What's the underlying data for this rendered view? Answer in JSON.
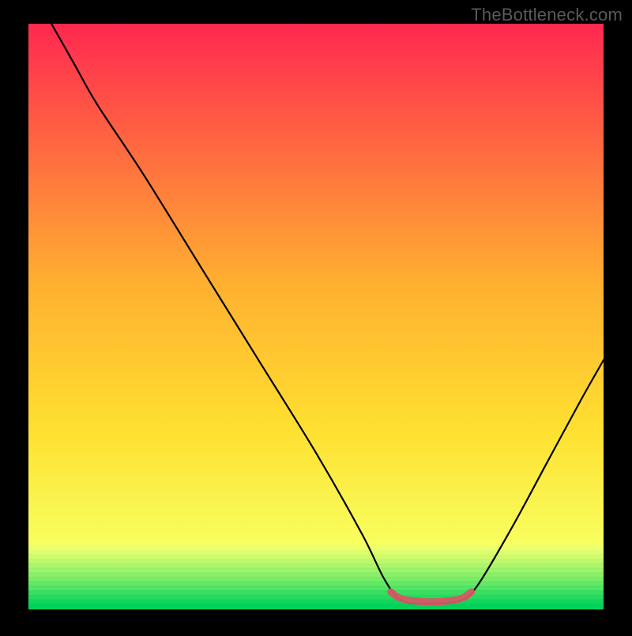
{
  "watermark": "TheBottleneck.com",
  "chart_data": {
    "type": "line",
    "title": "",
    "xlabel": "",
    "ylabel": "",
    "xlim": [
      0,
      100
    ],
    "ylim": [
      0,
      100
    ],
    "grid": false,
    "background_gradient": [
      {
        "offset": 0.0,
        "color": "#ff2850"
      },
      {
        "offset": 0.45,
        "color": "#ffb030"
      },
      {
        "offset": 0.7,
        "color": "#ffe030"
      },
      {
        "offset": 0.9,
        "color": "#f7ff60"
      },
      {
        "offset": 0.97,
        "color": "#a8ff60"
      },
      {
        "offset": 1.0,
        "color": "#00e060"
      }
    ],
    "series": [
      {
        "name": "bottleneck-curve",
        "stroke": "#000000",
        "stroke_width": 2.2,
        "points": [
          {
            "x": 4,
            "y": 100
          },
          {
            "x": 8,
            "y": 93
          },
          {
            "x": 12,
            "y": 86
          },
          {
            "x": 20,
            "y": 74
          },
          {
            "x": 30,
            "y": 58
          },
          {
            "x": 40,
            "y": 42
          },
          {
            "x": 50,
            "y": 26
          },
          {
            "x": 58,
            "y": 12
          },
          {
            "x": 62,
            "y": 4
          },
          {
            "x": 65,
            "y": 0.5
          },
          {
            "x": 70,
            "y": 0
          },
          {
            "x": 75,
            "y": 0.5
          },
          {
            "x": 78,
            "y": 3
          },
          {
            "x": 84,
            "y": 13
          },
          {
            "x": 90,
            "y": 24
          },
          {
            "x": 96,
            "y": 35
          },
          {
            "x": 100,
            "y": 42
          }
        ]
      },
      {
        "name": "optimal-range-marker",
        "stroke": "#d45a65",
        "stroke_width": 9,
        "points": [
          {
            "x": 63,
            "y": 2.0
          },
          {
            "x": 65,
            "y": 0.8
          },
          {
            "x": 70,
            "y": 0.3
          },
          {
            "x": 75,
            "y": 0.8
          },
          {
            "x": 77,
            "y": 2.0
          }
        ]
      }
    ],
    "annotations": [],
    "colors": {
      "frame": "#000000"
    }
  }
}
